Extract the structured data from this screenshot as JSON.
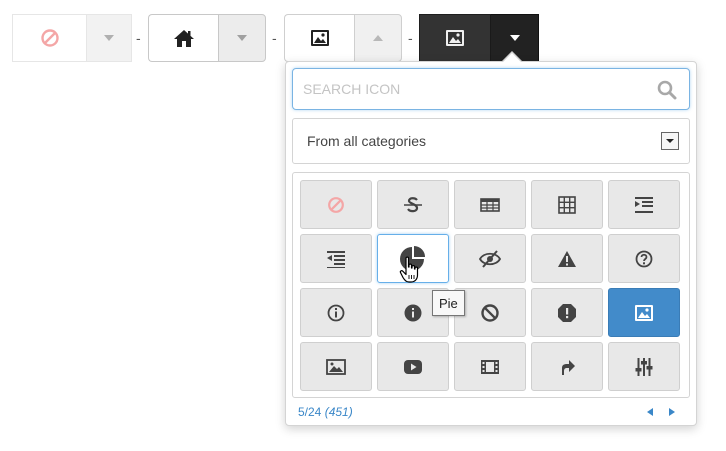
{
  "pickers": [
    {
      "icon": "ban-icon",
      "caret": "caret-down-icon",
      "style": "disabled"
    },
    {
      "icon": "home-icon",
      "caret": "caret-down-icon",
      "style": "default"
    },
    {
      "icon": "picture-icon",
      "caret": "caret-up-icon",
      "style": "open"
    },
    {
      "icon": "picture-icon",
      "caret": "caret-down-icon",
      "style": "inverse"
    }
  ],
  "separator": "-",
  "search": {
    "placeholder": "SEARCH ICON",
    "value": "",
    "icon": "search-icon"
  },
  "category": {
    "selected": "From all categories"
  },
  "icons": [
    {
      "name": "ban-icon",
      "state": "disabled"
    },
    {
      "name": "strikethrough-icon",
      "state": "normal"
    },
    {
      "name": "table-icon",
      "state": "normal"
    },
    {
      "name": "th-icon",
      "state": "normal"
    },
    {
      "name": "indent-icon",
      "state": "normal"
    },
    {
      "name": "outdent-icon",
      "state": "normal"
    },
    {
      "name": "pie-chart-icon",
      "state": "hover"
    },
    {
      "name": "eye-slash-icon",
      "state": "normal"
    },
    {
      "name": "warning-icon",
      "state": "normal"
    },
    {
      "name": "question-circle-icon",
      "state": "normal"
    },
    {
      "name": "info-circle-o-icon",
      "state": "normal"
    },
    {
      "name": "info-circle-icon",
      "state": "normal"
    },
    {
      "name": "ban-circle-icon",
      "state": "normal"
    },
    {
      "name": "exclamation-octagon-icon",
      "state": "normal"
    },
    {
      "name": "picture-icon",
      "state": "selected"
    },
    {
      "name": "image-icon",
      "state": "normal"
    },
    {
      "name": "youtube-play-icon",
      "state": "normal"
    },
    {
      "name": "film-icon",
      "state": "normal"
    },
    {
      "name": "share-icon",
      "state": "normal"
    },
    {
      "name": "sliders-icon",
      "state": "normal"
    }
  ],
  "tooltip": {
    "text": "Pie"
  },
  "pagination": {
    "page": "5/24",
    "total": "(451)"
  },
  "colors": {
    "accent": "#428bca",
    "link": "#3a87c8",
    "disabled_icon": "#f4a6a6",
    "icon": "#444444"
  }
}
